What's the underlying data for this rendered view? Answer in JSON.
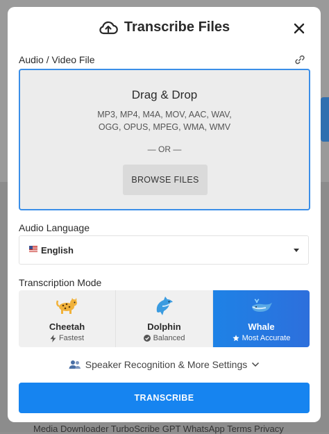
{
  "modal": {
    "title": "Transcribe Files",
    "file_label": "Audio / Video File",
    "dropzone": {
      "title": "Drag & Drop",
      "formats_line1": "MP3, MP4, M4A, MOV, AAC, WAV,",
      "formats_line2": "OGG, OPUS, MPEG, WMA, WMV",
      "or_text": "— OR —",
      "browse_label": "BROWSE FILES"
    },
    "language_label": "Audio Language",
    "language": {
      "flag": "🇺🇸",
      "value": "English"
    },
    "mode_label": "Transcription Mode",
    "modes": [
      {
        "name": "Cheetah",
        "sub": "Fastest",
        "icon": "bolt-icon",
        "emoji": "leopard"
      },
      {
        "name": "Dolphin",
        "sub": "Balanced",
        "icon": "check-circle-icon",
        "emoji": "dolphin"
      },
      {
        "name": "Whale",
        "sub": "Most Accurate",
        "icon": "star-icon",
        "emoji": "whale",
        "selected": true
      }
    ],
    "settings_label": "Speaker Recognition & More Settings",
    "transcribe_label": "TRANSCRIBE"
  },
  "background": {
    "footer_text": "Media Downloader   TurboScribe GPT   WhatsApp   Terms   Privacy"
  },
  "colors": {
    "accent": "#1684f0",
    "selected_mode": "#1e82e6",
    "dropzone_border": "#3a8ee8"
  }
}
